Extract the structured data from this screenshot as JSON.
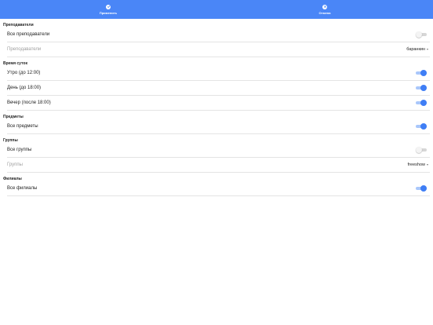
{
  "header": {
    "apply_label": "Применить",
    "cancel_label": "Отмена",
    "accent_color": "#4a86f7"
  },
  "sections": {
    "teachers": {
      "title": "Преподаватели",
      "all_label": "Все преподаватели",
      "all_enabled": false,
      "picker_placeholder": "Преподаватели",
      "picker_value": "баранкин"
    },
    "time_of_day": {
      "title": "Время суток",
      "morning_label": "Утро (до 12:00)",
      "morning_enabled": true,
      "day_label": "День (до 18:00)",
      "day_enabled": true,
      "evening_label": "Вечер (после 18:00)",
      "evening_enabled": true
    },
    "subjects": {
      "title": "Предметы",
      "all_label": "Все предметы",
      "all_enabled": true
    },
    "groups": {
      "title": "Группы",
      "all_label": "Все группы",
      "all_enabled": false,
      "picker_placeholder": "Группы",
      "picker_value": "freeshow"
    },
    "branches": {
      "title": "Филиалы",
      "all_label": "Все филиалы",
      "all_enabled": true
    }
  },
  "icons": {
    "apply": "check-circle-icon",
    "cancel": "close-circle-icon"
  }
}
